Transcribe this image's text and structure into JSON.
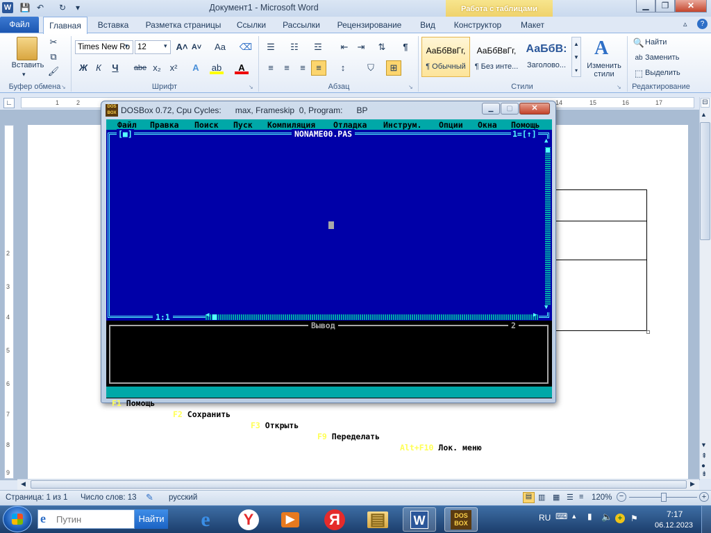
{
  "app": {
    "title": "Документ1  -  Microsoft Word",
    "context_tab": "Работа с таблицами"
  },
  "window_buttons": {
    "minimize": "▁",
    "restore": "❐",
    "close": "✕"
  },
  "tabs": [
    {
      "label": "Файл"
    },
    {
      "label": "Главная"
    },
    {
      "label": "Вставка"
    },
    {
      "label": "Разметка страницы"
    },
    {
      "label": "Ссылки"
    },
    {
      "label": "Рассылки"
    },
    {
      "label": "Рецензирование"
    },
    {
      "label": "Вид"
    },
    {
      "label": "Конструктор"
    },
    {
      "label": "Макет"
    }
  ],
  "ribbon": {
    "clipboard": {
      "paste": "Вставить",
      "label": "Буфер обмена"
    },
    "font": {
      "name": "Times New Ro",
      "size": "12",
      "label": "Шрифт",
      "bold": "Ж",
      "italic": "К",
      "underline": "Ч",
      "strike": "abe",
      "sub": "x₂",
      "sup": "x²",
      "grow": "A˄",
      "shrink": "A˅",
      "case": "Aa",
      "color": "A"
    },
    "paragraph": {
      "label": "Абзац",
      "pilcrow": "¶"
    },
    "styles": {
      "label": "Стили",
      "items": [
        {
          "preview": "АаБбВвГг,",
          "name": "¶ Обычный"
        },
        {
          "preview": "АаБбВвГг,",
          "name": "¶ Без инте..."
        },
        {
          "preview": "АаБбВ:",
          "name": "Заголово..."
        }
      ],
      "change": "Изменить стили"
    },
    "editing": {
      "label": "Редактирование",
      "find": "Найти",
      "replace": "Заменить",
      "select": "Выделить"
    }
  },
  "ruler": {
    "h_ticks": [
      "1",
      "2",
      "1",
      "14",
      "15",
      "16",
      "17"
    ],
    "v_ticks": [
      "1",
      "2",
      "3",
      "4",
      "5",
      "6",
      "7",
      "8",
      "9"
    ]
  },
  "status": {
    "page": "Страница: 1 из 1",
    "words": "Число слов: 13",
    "lang": "русский",
    "zoom": "120%"
  },
  "dosbox": {
    "title": "DOSBox 0.72, Cpu Cycles:      max, Frameskip  0, Program:      BP",
    "icon_text": "DOS BOX",
    "menu": [
      "Файл",
      "Правка",
      "Поиск",
      "Пуск",
      "Компиляция",
      "Отладка",
      "Инструм.",
      "Опции",
      "Окна",
      "Помощь"
    ],
    "editor": {
      "close_box": "[■]",
      "filename": "NONAME00.PAS",
      "window_no": "1=[↑]",
      "position": "1:1"
    },
    "output": {
      "title": "Вывод",
      "window_no": "2"
    },
    "status": [
      {
        "key": "F1",
        "label": "Помощь"
      },
      {
        "key": "F2",
        "label": "Сохранить"
      },
      {
        "key": "F3",
        "label": "Открыть"
      },
      {
        "key": "F9",
        "label": "Переделать"
      },
      {
        "key": "Alt+F10",
        "label": "Лок. меню"
      }
    ]
  },
  "taskbar": {
    "search_placeholder": "Путин",
    "search_button": "Найти",
    "lang": "RU",
    "time": "7:17",
    "date": "06.12.2023",
    "apps": [
      {
        "name": "ie",
        "glyph": "e"
      },
      {
        "name": "yandex-browser",
        "glyph": "Y"
      },
      {
        "name": "media",
        "glyph": "▶"
      },
      {
        "name": "yandex",
        "glyph": "Я"
      },
      {
        "name": "explorer",
        "glyph": "▤"
      },
      {
        "name": "word",
        "glyph": "W"
      },
      {
        "name": "dosbox",
        "glyph": "DOS BOX"
      }
    ]
  },
  "colors": {
    "dos_blue": "#0000a8",
    "dos_cyan": "#00a8a8",
    "dos_fkey": "#ffff55",
    "word_blue": "#2b579a"
  }
}
